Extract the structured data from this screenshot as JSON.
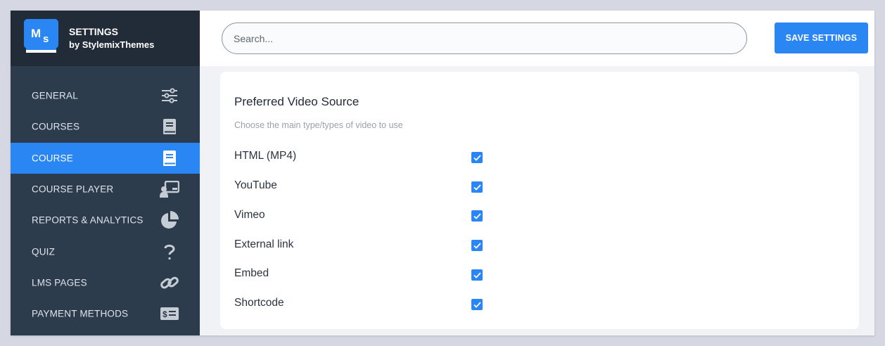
{
  "brand": {
    "logo_text": "MS",
    "title": "SETTINGS",
    "subtitle": "by StylemixThemes"
  },
  "sidebar": {
    "items": [
      {
        "label": "GENERAL",
        "icon": "sliders-icon",
        "active": false
      },
      {
        "label": "COURSES",
        "icon": "book-icon",
        "active": false
      },
      {
        "label": "COURSE",
        "icon": "book-open-icon",
        "active": true
      },
      {
        "label": "COURSE PLAYER",
        "icon": "presenter-icon",
        "active": false
      },
      {
        "label": "REPORTS & ANALYTICS",
        "icon": "pie-chart-icon",
        "active": false
      },
      {
        "label": "QUIZ",
        "icon": "question-icon",
        "active": false
      },
      {
        "label": "LMS PAGES",
        "icon": "link-icon",
        "active": false
      },
      {
        "label": "PAYMENT METHODS",
        "icon": "money-icon",
        "active": false
      }
    ]
  },
  "header": {
    "search_placeholder": "Search...",
    "save_label": "SAVE SETTINGS"
  },
  "section": {
    "title": "Preferred Video Source",
    "description": "Choose the main type/types of video to use",
    "options": [
      {
        "label": "HTML (MP4)",
        "checked": true
      },
      {
        "label": "YouTube",
        "checked": true
      },
      {
        "label": "Vimeo",
        "checked": true
      },
      {
        "label": "External link",
        "checked": true
      },
      {
        "label": "Embed",
        "checked": true
      },
      {
        "label": "Shortcode",
        "checked": true
      }
    ]
  },
  "colors": {
    "accent": "#2a86f3",
    "sidebar_bg": "#2d3c4d",
    "brand_bg": "#222b38"
  }
}
